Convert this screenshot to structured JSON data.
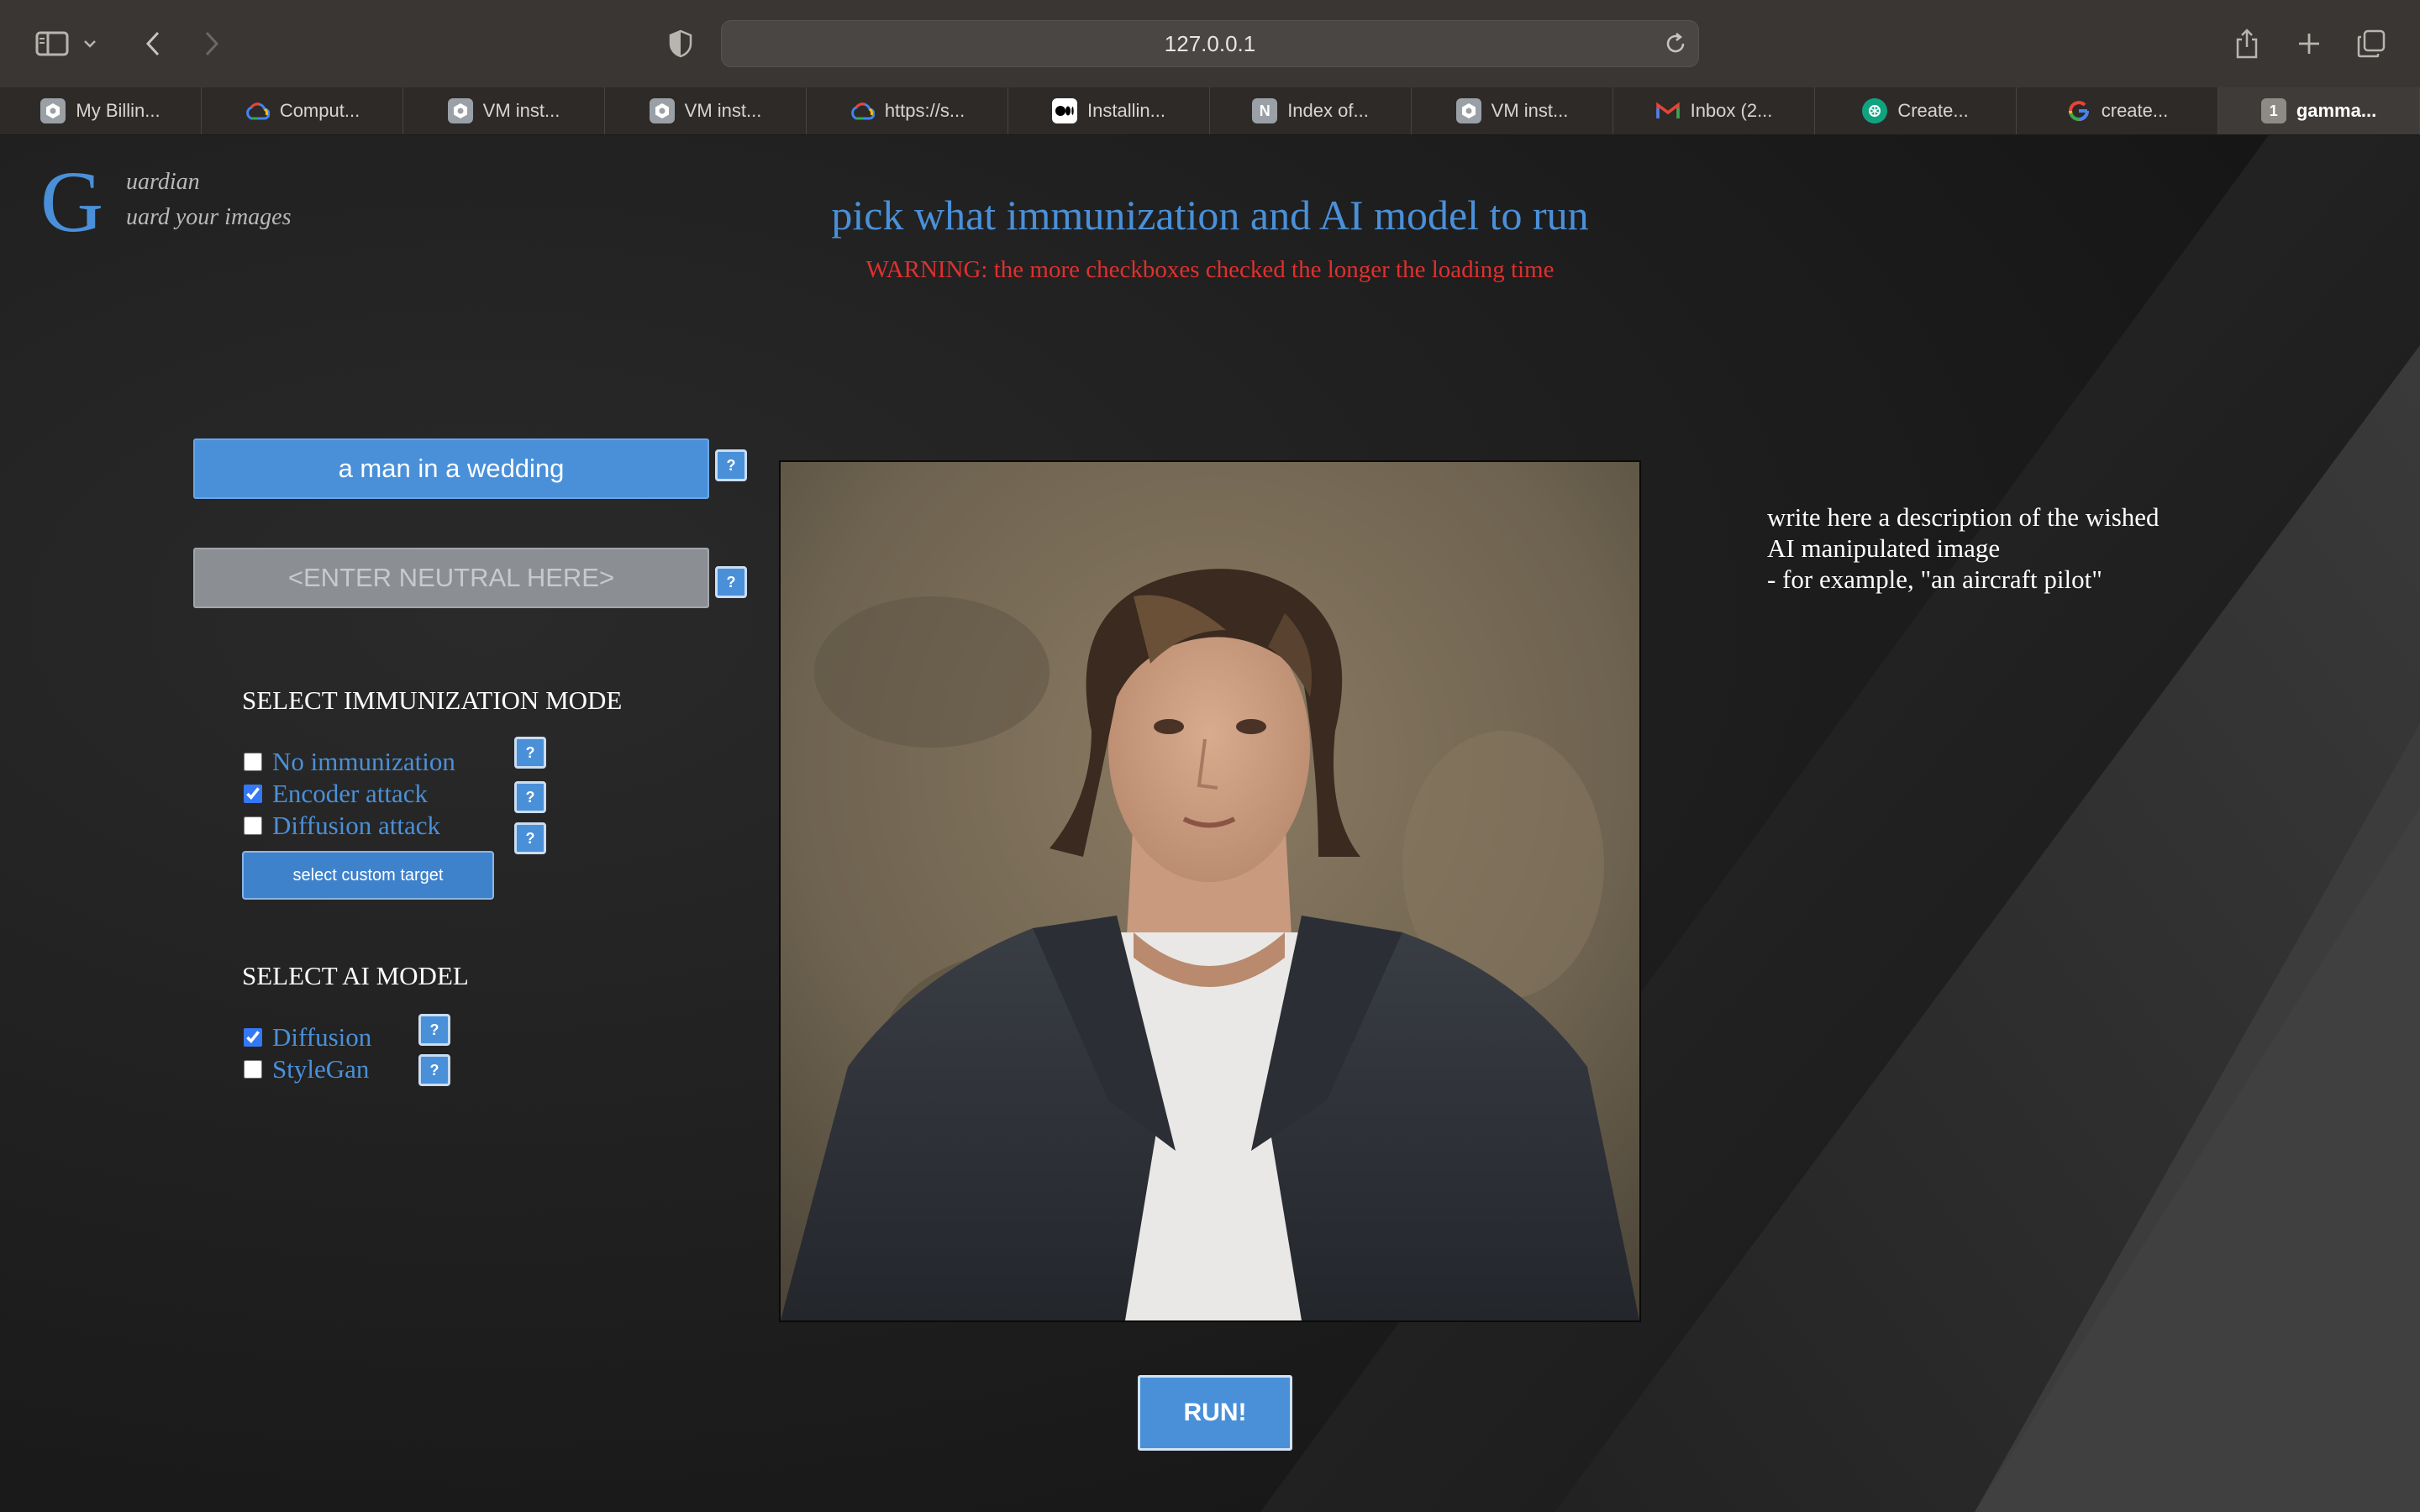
{
  "browser": {
    "url": "127.0.0.1",
    "tabs": [
      {
        "label": "My Billin...",
        "icon": "gcp-hex-icon"
      },
      {
        "label": "Comput...",
        "icon": "google-cloud-icon"
      },
      {
        "label": "VM inst...",
        "icon": "gcp-hex-icon"
      },
      {
        "label": "VM inst...",
        "icon": "gcp-hex-icon"
      },
      {
        "label": "https://s...",
        "icon": "google-cloud-icon"
      },
      {
        "label": "Installin...",
        "icon": "medium-icon"
      },
      {
        "label": "Index of...",
        "icon": "notion-icon"
      },
      {
        "label": "VM inst...",
        "icon": "gcp-hex-icon"
      },
      {
        "label": "Inbox (2...",
        "icon": "gmail-icon"
      },
      {
        "label": "Create...",
        "icon": "openai-icon"
      },
      {
        "label": "create...",
        "icon": "google-icon"
      },
      {
        "label": "gamma...",
        "icon": "numbered-tab-icon",
        "badge": "1",
        "active": true
      }
    ]
  },
  "logo": {
    "letter": "G",
    "line1": "uardian",
    "line2": "uard your images"
  },
  "header": {
    "title": "pick what immunization and AI model to run",
    "warning": "WARNING: the more checkboxes checked the longer the loading time"
  },
  "prompt": {
    "value": "a man in a wedding",
    "neutral_placeholder": "<ENTER NEUTRAL HERE>",
    "help_label": "?"
  },
  "immunization": {
    "title": "SELECT IMMUNIZATION MODE",
    "options": [
      {
        "label": "No immunization",
        "checked": false
      },
      {
        "label": "Encoder attack",
        "checked": true
      },
      {
        "label": "Diffusion attack",
        "checked": false
      }
    ],
    "custom_target_label": "select custom target"
  },
  "ai_model": {
    "title": "SELECT AI MODEL",
    "options": [
      {
        "label": "Diffusion",
        "checked": true
      },
      {
        "label": "StyleGan",
        "checked": false
      }
    ]
  },
  "description": {
    "lines": [
      "write here a description of the wished",
      "AI manipulated image",
      "- for example, \"an aircraft pilot\""
    ]
  },
  "run_label": "RUN!",
  "colors": {
    "accent": "#4a90d9",
    "warning": "#e0302e",
    "background": "#1f1f1f"
  }
}
